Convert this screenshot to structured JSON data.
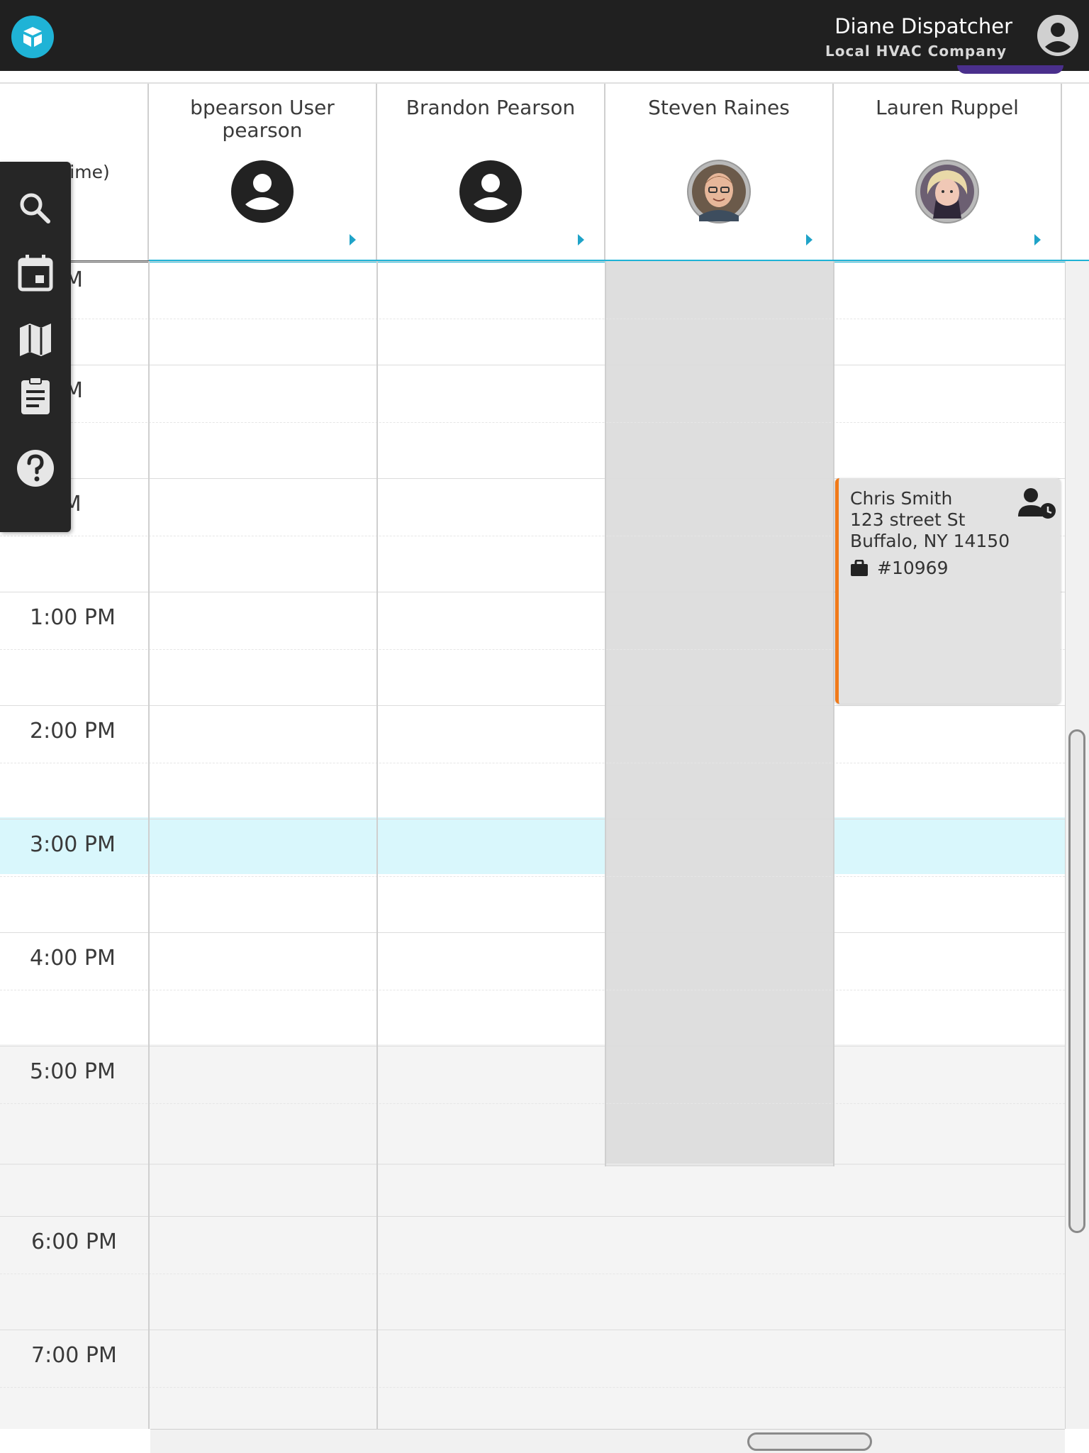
{
  "topbar": {
    "user_name": "Diane Dispatcher",
    "company": "Local HVAC Company"
  },
  "time_header": "n Time)",
  "technicians": [
    {
      "name": "bpearson User pearson",
      "avatar": "default-user-icon"
    },
    {
      "name": "Brandon Pearson",
      "avatar": "default-user-icon"
    },
    {
      "name": "Steven Raines",
      "avatar": "photo"
    },
    {
      "name": "Lauren Ruppel",
      "avatar": "photo"
    }
  ],
  "times": [
    "0 AM",
    "0 AM",
    "0 PM",
    "1:00 PM",
    "2:00 PM",
    "3:00 PM",
    "4:00 PM",
    "5:00 PM",
    "6:00 PM",
    "7:00 PM"
  ],
  "sidebar": [
    "search-icon",
    "calendar-icon",
    "map-icon",
    "clipboard-icon",
    "help-icon"
  ],
  "appointment": {
    "customer": "Chris Smith",
    "street": "123 street St",
    "city": "Buffalo, NY 14150",
    "job": "#10969"
  },
  "colors": {
    "accent": "#1fb3d6",
    "current_hour": "#d9f7fc",
    "unavailable": "#dedede",
    "appt_border": "#f07a1a"
  }
}
